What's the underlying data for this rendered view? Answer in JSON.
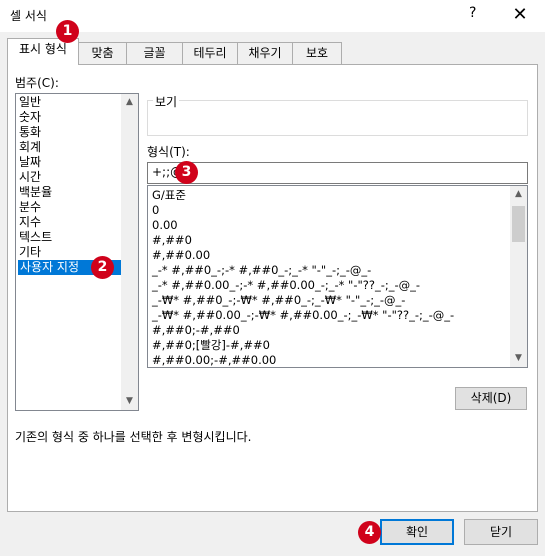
{
  "window": {
    "title": "셀 서식",
    "help": "?",
    "close": "✕"
  },
  "tabs": [
    {
      "label": "표시 형식"
    },
    {
      "label": "맞춤"
    },
    {
      "label": "글꼴"
    },
    {
      "label": "테두리"
    },
    {
      "label": "채우기"
    },
    {
      "label": "보호"
    }
  ],
  "category": {
    "label": "범주(C):",
    "items": [
      "일반",
      "숫자",
      "통화",
      "회계",
      "날짜",
      "시간",
      "백분율",
      "분수",
      "지수",
      "텍스트",
      "기타",
      "사용자 지정"
    ],
    "selected": "사용자 지정"
  },
  "sample": {
    "label": "보기"
  },
  "type": {
    "label": "형식(T):",
    "value": "+;;@",
    "formats": [
      "G/표준",
      "0",
      "0.00",
      "#,##0",
      "#,##0.00",
      "_-* #,##0_-;-* #,##0_-;_-* \"-\"_-;_-@_-",
      "_-* #,##0.00_-;-* #,##0.00_-;_-* \"-\"??_-;_-@_-",
      "_-₩* #,##0_-;-₩* #,##0_-;_-₩* \"-\"_-;_-@_-",
      "_-₩* #,##0.00_-;-₩* #,##0.00_-;_-₩* \"-\"??_-;_-@_-",
      "#,##0;-#,##0",
      "#,##0;[빨강]-#,##0",
      "#,##0.00;-#,##0.00"
    ]
  },
  "delete_button": "삭제(D)",
  "description": "기존의 형식 중 하나를 선택한 후 변형시킵니다.",
  "ok_button": "확인",
  "close_button": "닫기",
  "badges": [
    "1",
    "2",
    "3",
    "4"
  ],
  "colors": {
    "selection": "#0078d7",
    "badge": "#d0021b",
    "default_button_border": "#0078d7"
  }
}
